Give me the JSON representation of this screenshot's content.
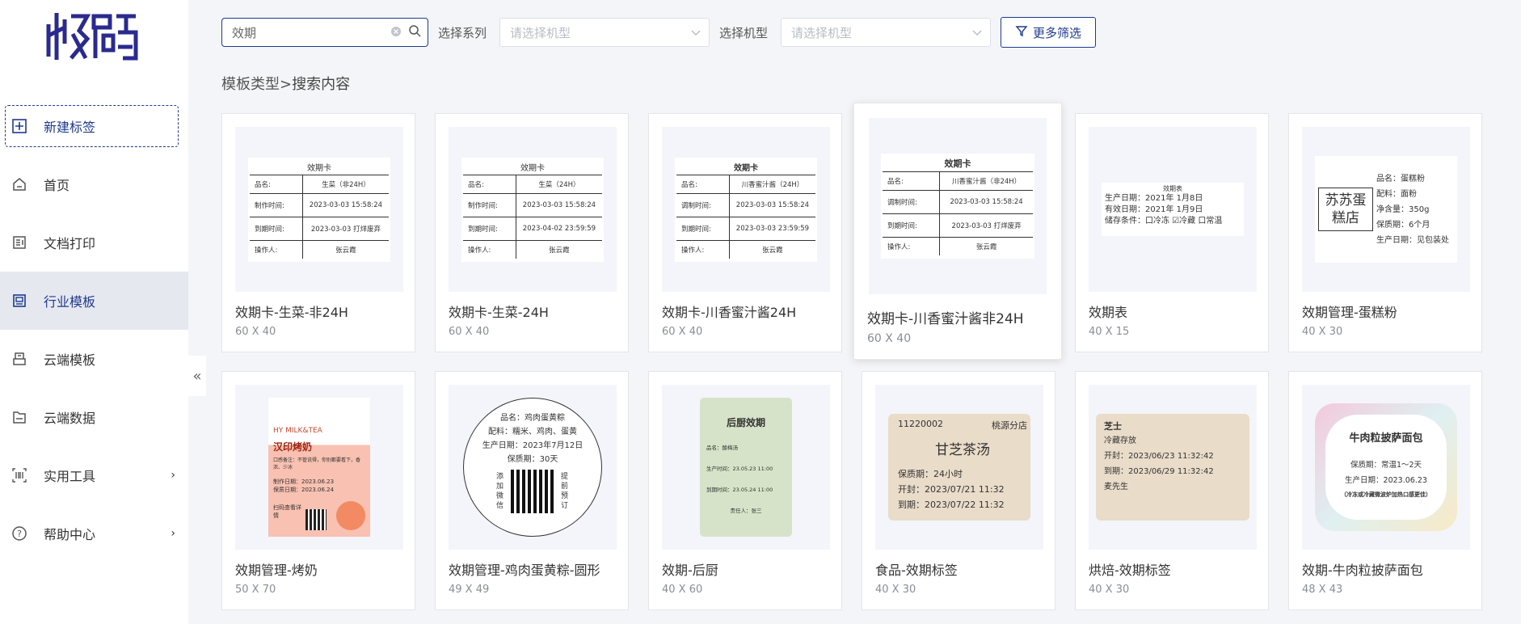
{
  "logo": {
    "text": "精臣"
  },
  "sidebar": {
    "items": [
      {
        "label": "新建标签",
        "icon": "plus-square-icon"
      },
      {
        "label": "首页",
        "icon": "home-icon"
      },
      {
        "label": "文档打印",
        "icon": "document-icon"
      },
      {
        "label": "行业模板",
        "icon": "template-icon"
      },
      {
        "label": "云端模板",
        "icon": "cloud-template-icon"
      },
      {
        "label": "云端数据",
        "icon": "folder-icon"
      },
      {
        "label": "实用工具",
        "icon": "barcode-scan-icon"
      },
      {
        "label": "帮助中心",
        "icon": "help-icon"
      }
    ],
    "collapse_glyph": "«"
  },
  "search": {
    "value": "效期",
    "placeholder": ""
  },
  "filters": {
    "series_label": "选择系列",
    "series_placeholder": "请选择机型",
    "model_label": "选择机型",
    "model_placeholder": "请选择机型",
    "more_label": "更多筛选"
  },
  "breadcrumb": {
    "root": "模板类型",
    "sep": ">",
    "current": "搜索内容"
  },
  "cards": [
    {
      "title": "效期卡-生菜-非24H",
      "size": "60 X 40",
      "label": {
        "head": "效期卡",
        "rows": [
          [
            "品名:",
            "生菜（非24H）"
          ],
          [
            "制作时间:",
            "2023-03-03 15:58:24"
          ],
          [
            "到期时间:",
            "2023-03-03   打烊废弃"
          ],
          [
            "操作人:",
            "张云霞"
          ]
        ]
      }
    },
    {
      "title": "效期卡-生菜-24H",
      "size": "60 X 40",
      "label": {
        "head": "效期卡",
        "rows": [
          [
            "品名:",
            "生菜（24H）"
          ],
          [
            "制作时间:",
            "2023-03-03 15:58:24"
          ],
          [
            "到期时间:",
            "2023-04-02   23:59:59"
          ],
          [
            "操作人:",
            "张云霞"
          ]
        ]
      }
    },
    {
      "title": "效期卡-川香蜜汁酱24H",
      "size": "60 X 40",
      "label": {
        "head": "效期卡",
        "rows": [
          [
            "品名:",
            "川香蜜汁酱（24H）"
          ],
          [
            "调制时间:",
            "2023-03-03 15:58:24"
          ],
          [
            "到期时间:",
            "2023-03-03   23:59:59"
          ],
          [
            "操作人:",
            "张云霞"
          ]
        ]
      }
    },
    {
      "title": "效期卡-川香蜜汁酱非24H",
      "size": "60 X 40",
      "label": {
        "head": "效期卡",
        "rows": [
          [
            "品名:",
            "川香蜜汁酱（非24H）"
          ],
          [
            "调制时间:",
            "2023-03-03 15:58:24"
          ],
          [
            "到期时间:",
            "2023-03-03   打烊废弃"
          ],
          [
            "操作人:",
            "张云霞"
          ]
        ]
      }
    },
    {
      "title": "效期表",
      "size": "40 X 15",
      "label": {
        "head": "效期表",
        "lines": [
          "生产日期：2021年 1月8日",
          "有效日期：2021年 1月9日",
          "储存条件：口冷冻 ☑冷藏 口常温"
        ]
      }
    },
    {
      "title": "效期管理-蛋糕粉",
      "size": "40 X 30",
      "label": {
        "shop": "苏苏蛋糕店",
        "lines": [
          "品名：蛋糕粉",
          "配料：面粉",
          "净含量：350g",
          "保质期：6个月",
          "生产日期：见包装处"
        ]
      }
    },
    {
      "title": "效期管理-烤奶",
      "size": "50 X 70",
      "label": {
        "brand": "HY MILK&TEA",
        "name": "汉印烤奶",
        "lines": [
          "口感备注：不管说得，你别都要看下，香浓、少冰",
          "制作日期：2023.06.23",
          "保质日期：2023.06.24"
        ],
        "scan": "扫码查看详情"
      }
    },
    {
      "title": "效期管理-鸡肉蛋黄粽-圆形",
      "size": "49 X 49",
      "label": {
        "lines": [
          "品名：鸡肉蛋黄粽",
          "配料：糯米、鸡肉、蛋黄",
          "生产日期：2023年7月12日",
          "保质期：30天"
        ],
        "left": "添加微信",
        "right": "提前预订"
      }
    },
    {
      "title": "效期-后厨",
      "size": "40 X 60",
      "label": {
        "head": "后厨效期",
        "lines": [
          "品名：酸梅汤",
          "生产时间：23.05.23 11:00",
          "到期时间：23.05.24 11:00",
          "责任人：张三"
        ]
      }
    },
    {
      "title": "食品-效期标签",
      "size": "40 X 30",
      "label": {
        "code": "11220002",
        "branch": "桃源分店",
        "name": "甘芝茶汤",
        "lines": [
          "保质期：24小时",
          "开封：2023/07/21  11:32",
          "到期：2023/07/22  11:32"
        ]
      }
    },
    {
      "title": "烘焙-效期标签",
      "size": "40 X 30",
      "label": {
        "head": "芝士",
        "lines": [
          "冷藏存放",
          "开封：2023/06/23 11:32:42",
          "到期：2023/06/29 11:32:42",
          "",
          "麦先生"
        ]
      }
    },
    {
      "title": "效期-牛肉粒披萨面包",
      "size": "48 X 43",
      "label": {
        "head": "牛肉粒披萨面包",
        "lines": [
          "保质期：常温1～2天",
          "生产日期：2023.06.23",
          "（冷冻或冷藏微波炉加热口感更佳）"
        ]
      }
    }
  ],
  "colors": {
    "accent": "#1f3a8c",
    "active_bg": "#e6e8f0",
    "page_bg": "#f4f5f8"
  }
}
